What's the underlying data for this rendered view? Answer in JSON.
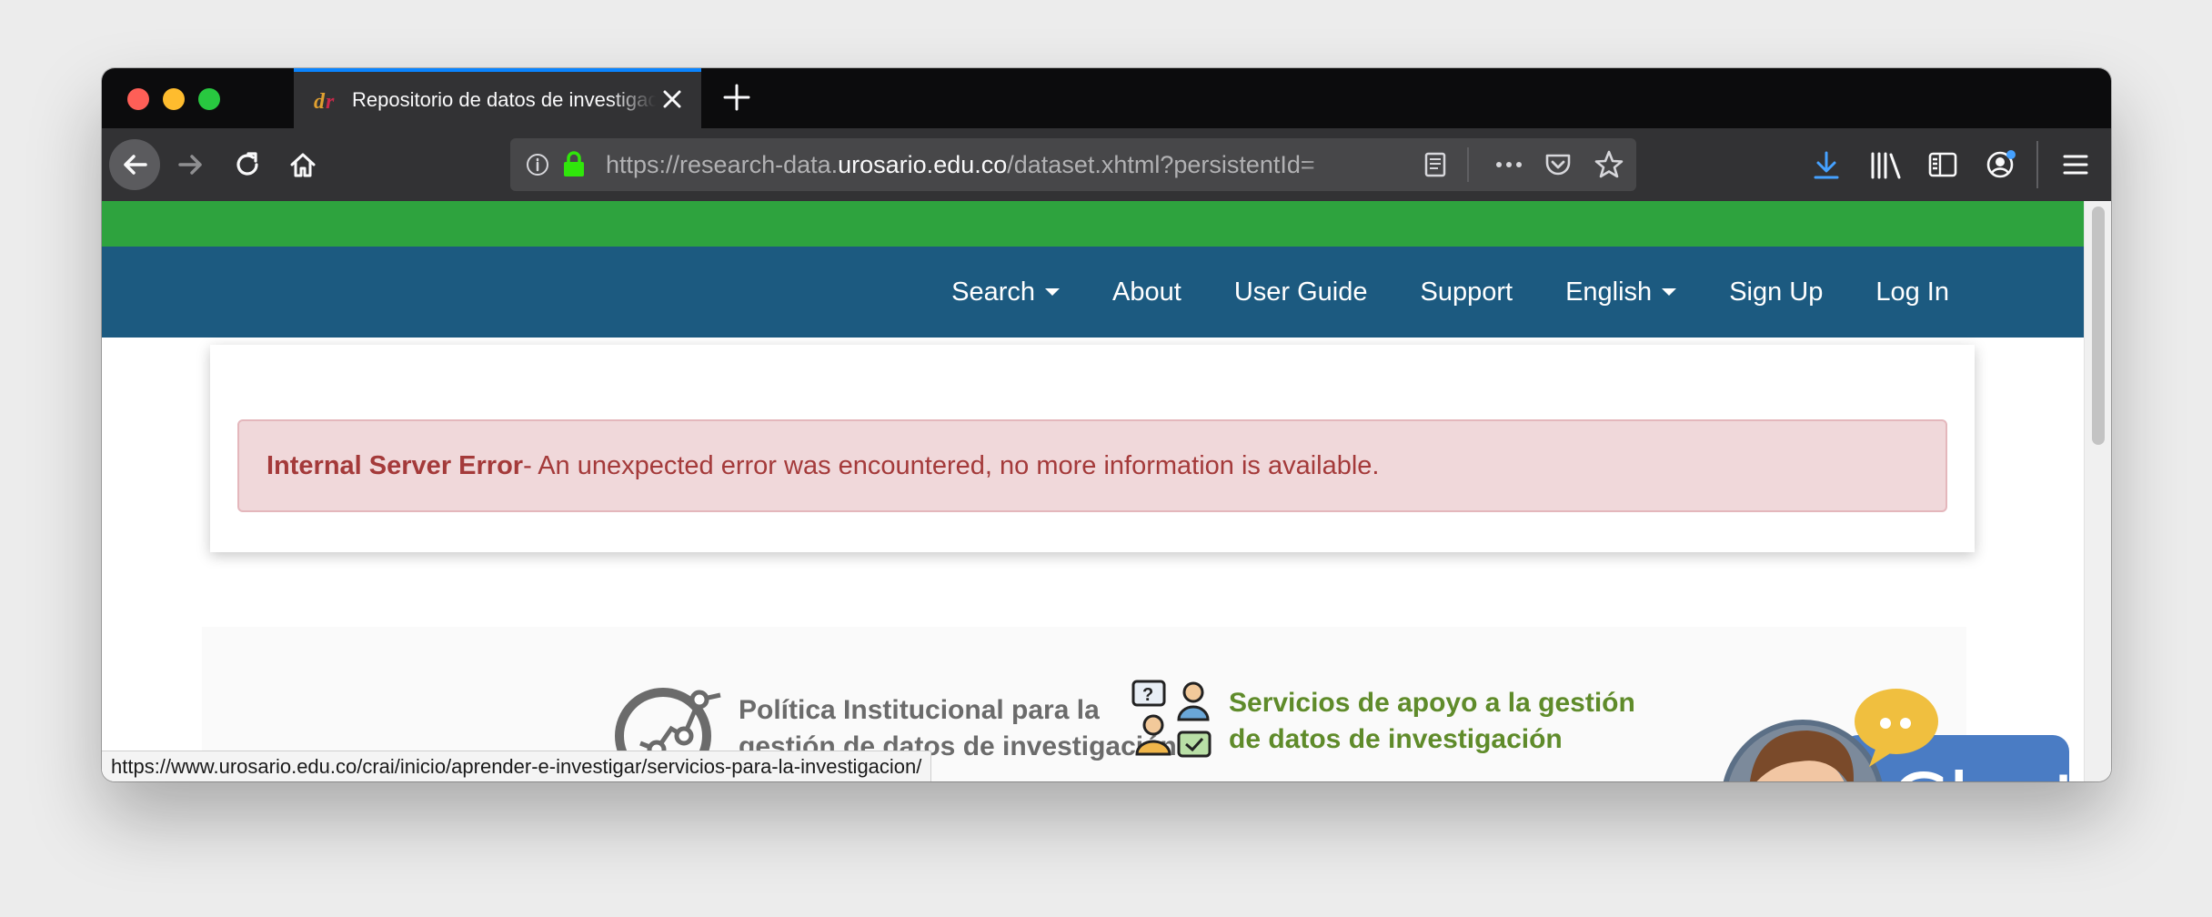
{
  "browser": {
    "tab_title": "Repositorio de datos de investigación",
    "url_prefix": "https://research-data.",
    "url_host": "urosario.edu.co",
    "url_path": "/dataset.xhtml?persistentId=",
    "status_url": "https://www.urosario.edu.co/crai/inicio/aprender-e-investigar/servicios-para-la-investigacion/"
  },
  "nav": {
    "search": "Search",
    "about": "About",
    "user_guide": "User Guide",
    "support": "Support",
    "language": "English",
    "sign_up": "Sign Up",
    "log_in": "Log In"
  },
  "alert": {
    "title": "Internal Server Error",
    "message": " - An unexpected error was encountered, no more information is available."
  },
  "promo": {
    "policy_line1": "Política Institucional para la",
    "policy_line2": "gestión de datos de investigación",
    "services_line1": "Servicios de apoyo a la gestión",
    "services_line2": "de datos de investigación"
  },
  "chat": {
    "label": "Chat"
  },
  "colors": {
    "green_bar": "#2ea33e",
    "nav_blue": "#1c5a80",
    "alert_bg": "#f0d8da",
    "alert_text": "#a43a3a",
    "chat_blue": "#4a7cc4"
  }
}
